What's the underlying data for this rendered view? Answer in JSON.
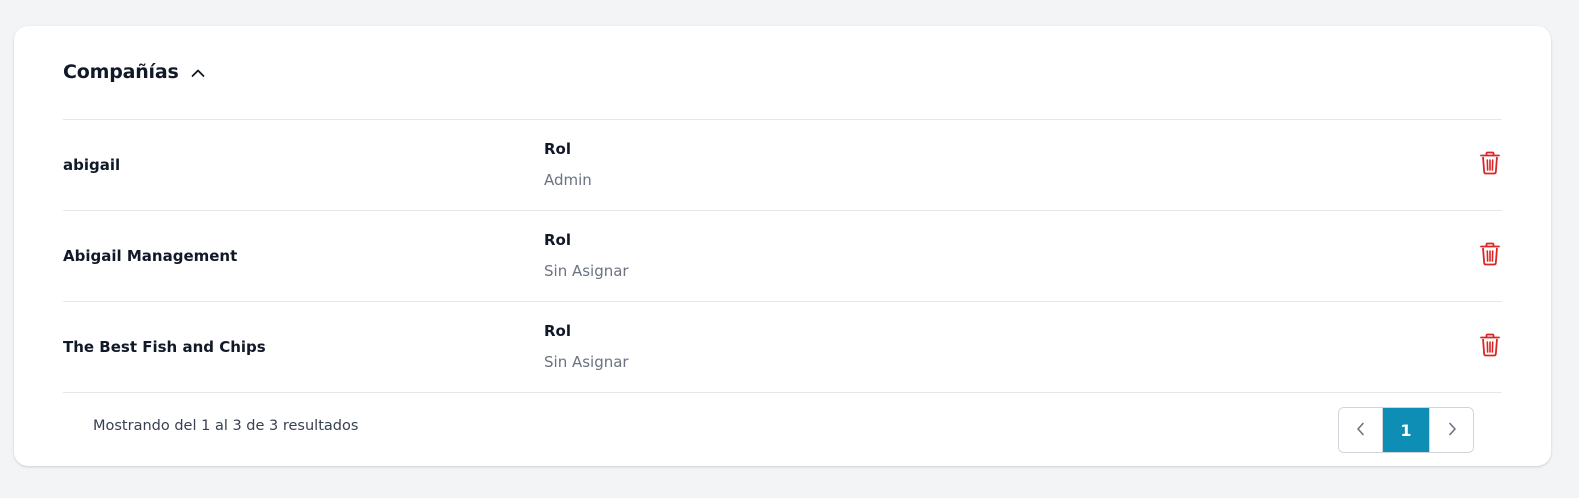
{
  "section": {
    "title": "Compañías",
    "toggle_icon": "chevron-up-icon"
  },
  "companies": [
    {
      "name": "abigail",
      "role_label": "Rol",
      "role_value": "Admin"
    },
    {
      "name": "Abigail Management",
      "role_label": "Rol",
      "role_value": "Sin Asignar"
    },
    {
      "name": "The Best Fish and Chips",
      "role_label": "Rol",
      "role_value": "Sin Asignar"
    }
  ],
  "footer": {
    "results_text": "Mostrando del 1 al 3 de 3 resultados"
  },
  "pagination": {
    "current_page": "1",
    "prev_icon": "chevron-left-icon",
    "next_icon": "chevron-right-icon"
  },
  "colors": {
    "accent": "#0e8db5",
    "delete": "#dc2626",
    "text_primary": "#111827",
    "text_muted": "#6b7280"
  }
}
